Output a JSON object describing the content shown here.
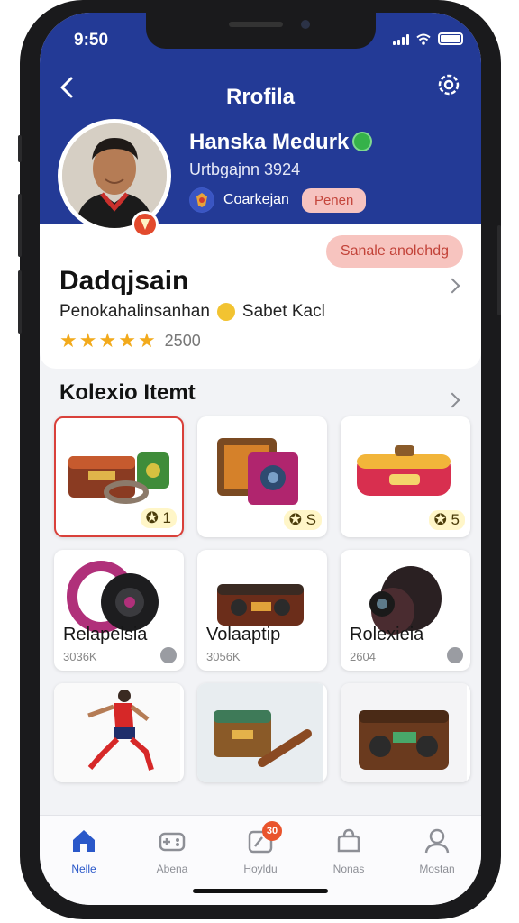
{
  "status": {
    "time": "9:50"
  },
  "header": {
    "title": "Rrofila",
    "user_name": "Hanska Medurk",
    "user_sub": "Urtbgajnn 3924",
    "team_label": "Coarkejan",
    "follow_label": "Penen"
  },
  "info": {
    "share_label": "Sanale anolohdg",
    "title": "Dadqjsain",
    "subtitle": "Penokahalinsanhan",
    "subtitle_extra": "Sabet Kacl",
    "rating_value": "2500",
    "stars": 5
  },
  "collection": {
    "title": "Kolexio Itemt",
    "items": [
      {
        "count": "1"
      },
      {
        "count": "S"
      },
      {
        "count": "5"
      },
      {
        "name": "Relapelsia",
        "meta": "3036K"
      },
      {
        "name": "Volaaptip",
        "meta": "3056K"
      },
      {
        "name": "Rolexieia",
        "meta": "2604"
      }
    ]
  },
  "tabs": [
    {
      "label": "Nelle",
      "icon": "home-icon",
      "active": true
    },
    {
      "label": "Abena",
      "icon": "gamepad-icon"
    },
    {
      "label": "Hoyldu",
      "icon": "dashboard-icon",
      "badge": "30"
    },
    {
      "label": "Nonas",
      "icon": "bag-icon"
    },
    {
      "label": "Mostan",
      "icon": "user-icon"
    }
  ],
  "colors": {
    "header_bg": "#233a96",
    "accent_red": "#d9403a",
    "pill_bg": "#f7c4bf",
    "active_tab": "#2a58c9"
  }
}
